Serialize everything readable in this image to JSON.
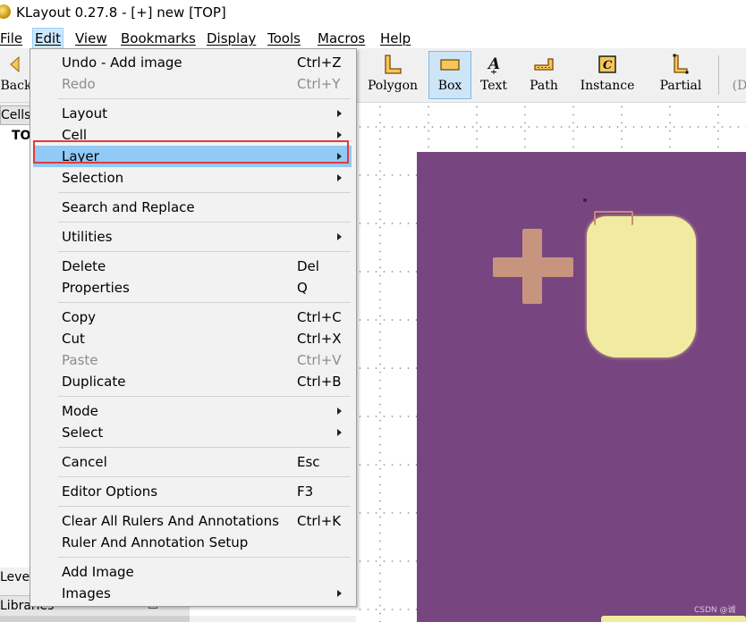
{
  "window": {
    "title": "KLayout 0.27.8 - [+] new [TOP]"
  },
  "menubar": [
    {
      "label": "File"
    },
    {
      "label": "Edit"
    },
    {
      "label": "View"
    },
    {
      "label": "Bookmarks"
    },
    {
      "label": "Display"
    },
    {
      "label": "Tools"
    },
    {
      "label": "Macros"
    },
    {
      "label": "Help"
    }
  ],
  "toolbar": {
    "back": "Back",
    "polygon": "Polygon",
    "box": "Box",
    "text": "Text",
    "path": "Path",
    "instance": "Instance",
    "partial": "Partial",
    "more": "(D"
  },
  "left_panel": {
    "cells_tab": "Cells",
    "top_node": "TOP",
    "levels_label": "Leve",
    "libraries_label": "Libraries"
  },
  "edit_menu": {
    "items": [
      {
        "label": "Undo - Add image",
        "shortcut": "Ctrl+Z"
      },
      {
        "label": "Redo",
        "shortcut": "Ctrl+Y",
        "disabled": true
      },
      {
        "label": "Layout",
        "submenu": true
      },
      {
        "label": "Cell",
        "submenu": true
      },
      {
        "label": "Layer",
        "submenu": true,
        "highlighted": true
      },
      {
        "label": "Selection",
        "submenu": true
      },
      {
        "label": "Search and Replace"
      },
      {
        "label": "Utilities",
        "submenu": true
      },
      {
        "label": "Delete",
        "shortcut": "Del"
      },
      {
        "label": "Properties",
        "shortcut": "Q"
      },
      {
        "label": "Copy",
        "shortcut": "Ctrl+C"
      },
      {
        "label": "Cut",
        "shortcut": "Ctrl+X"
      },
      {
        "label": "Paste",
        "shortcut": "Ctrl+V",
        "disabled": true
      },
      {
        "label": "Duplicate",
        "shortcut": "Ctrl+B"
      },
      {
        "label": "Mode",
        "submenu": true
      },
      {
        "label": "Select",
        "submenu": true
      },
      {
        "label": "Cancel",
        "shortcut": "Esc"
      },
      {
        "label": "Editor Options",
        "shortcut": "F3"
      },
      {
        "label": "Clear All Rulers And Annotations",
        "shortcut": "Ctrl+K"
      },
      {
        "label": "Ruler And Annotation Setup"
      },
      {
        "label": "Add Image"
      },
      {
        "label": "Images",
        "submenu": true
      }
    ]
  },
  "canvas": {
    "watermark": "CSDN @诚"
  },
  "colors": {
    "menu_highlight": "#91c9f7",
    "callout_border": "#e53935",
    "image_background": "#77457f",
    "pad_fill": "#f0eba0",
    "cross_fill": "#c7957e"
  }
}
